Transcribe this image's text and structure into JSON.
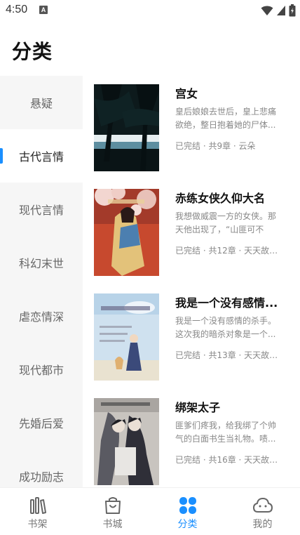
{
  "status_bar": {
    "time": "4:50",
    "notification_letter": "A"
  },
  "header": {
    "title": "分类"
  },
  "sidebar": {
    "items": [
      {
        "label": "悬疑",
        "active": false
      },
      {
        "label": "古代言情",
        "active": true
      },
      {
        "label": "现代言情",
        "active": false
      },
      {
        "label": "科幻末世",
        "active": false
      },
      {
        "label": "虐恋情深",
        "active": false
      },
      {
        "label": "现代都市",
        "active": false
      },
      {
        "label": "先婚后爱",
        "active": false
      },
      {
        "label": "成功励志",
        "active": false
      }
    ]
  },
  "books": [
    {
      "title": "宫女",
      "desc": "皇后娘娘去世后，皇上悲痛欲绝，整日抱着她的尸体...",
      "meta": "已完结 · 共9章 · 云朵"
    },
    {
      "title": "赤练女侠久仰大名",
      "desc": "我想做威震一方的女侠。那天他出现了，“山匪可不是...",
      "meta": "已完结 · 共12章 · 天天故事..."
    },
    {
      "title": "我是一个没有感情...",
      "desc": "我是一个没有感情的杀手。这次我的暗杀对象是一个...",
      "meta": "已完结 · 共13章 · 天天故事..."
    },
    {
      "title": "绑架太子",
      "desc": "匪爹们疼我，给我绑了个帅气的白面书生当礼物。啧...",
      "meta": "已完结 · 共16章 · 天天故事..."
    }
  ],
  "bottom_nav": {
    "items": [
      {
        "label": "书架",
        "icon": "bookshelf-icon",
        "active": false
      },
      {
        "label": "书城",
        "icon": "bookstore-bag-icon",
        "active": false
      },
      {
        "label": "分类",
        "icon": "category-icon",
        "active": true
      },
      {
        "label": "我的",
        "icon": "profile-cloud-icon",
        "active": false
      }
    ]
  },
  "colors": {
    "accent": "#1a8fff",
    "sidebar_bg": "#f6f6f6",
    "muted_text": "#888888"
  }
}
